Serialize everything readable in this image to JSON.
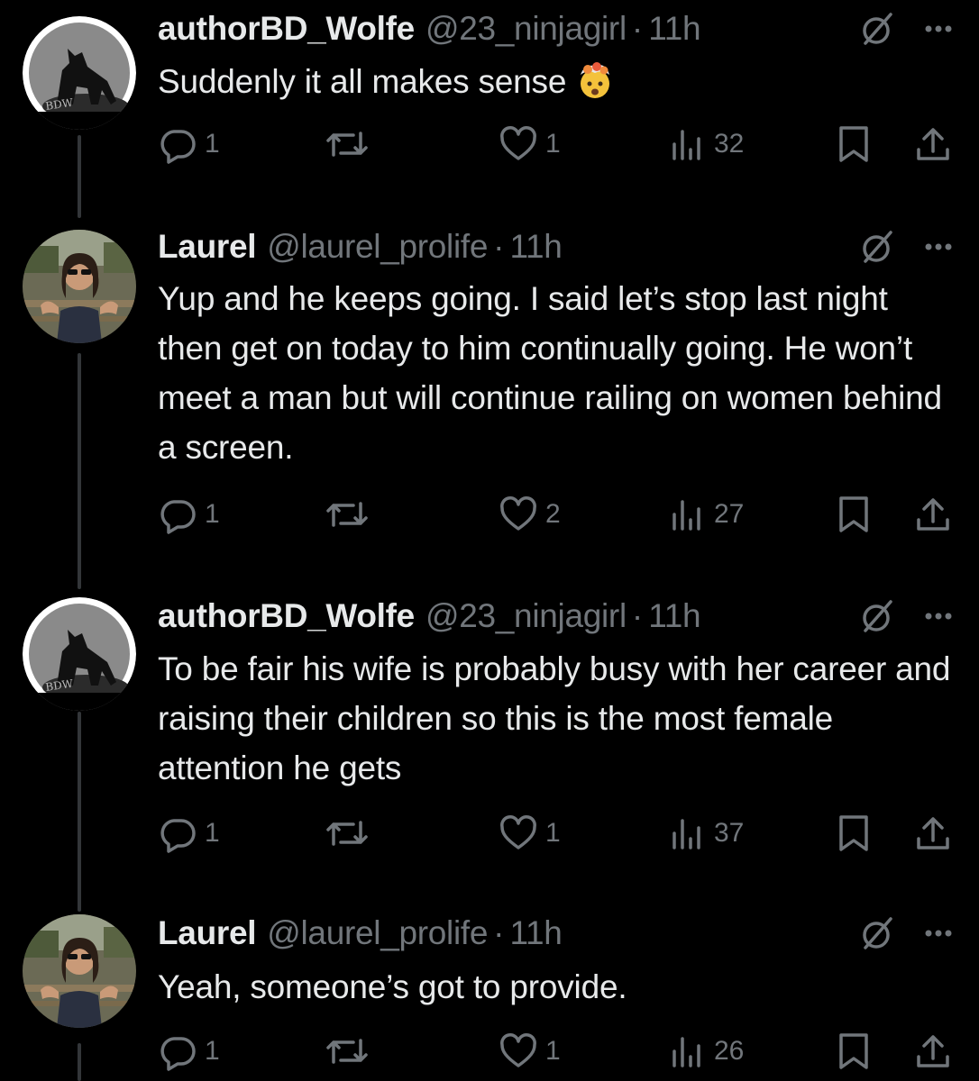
{
  "tweets": [
    {
      "name": "authorBD_Wolfe",
      "handle": "@23_ninjagirl",
      "separator": "·",
      "time": "11h",
      "text": "Suddenly it all makes sense",
      "emoji": "exploding-head",
      "avatar": "wolf-avatar",
      "avatar_text": "BDW",
      "replies": "1",
      "reposts": "",
      "likes": "1",
      "views": "32"
    },
    {
      "name": "Laurel",
      "handle": "@laurel_prolife",
      "separator": "·",
      "time": "11h",
      "text": "Yup and he keeps going. I said let’s stop last night then get on today to him continually going. He won’t meet a man but will continue railing on women behind a screen.",
      "avatar": "person-photo-avatar",
      "replies": "1",
      "reposts": "",
      "likes": "2",
      "views": "27"
    },
    {
      "name": "authorBD_Wolfe",
      "handle": "@23_ninjagirl",
      "separator": "·",
      "time": "11h",
      "text": "To be fair his wife is probably busy with her career and raising their children so this is the most female attention he gets",
      "avatar": "wolf-avatar",
      "avatar_text": "BDW",
      "replies": "1",
      "reposts": "",
      "likes": "1",
      "views": "37"
    },
    {
      "name": "Laurel",
      "handle": "@laurel_prolife",
      "separator": "·",
      "time": "11h",
      "text": "Yeah, someone’s got to provide.",
      "avatar": "person-photo-avatar",
      "replies": "1",
      "reposts": "",
      "likes": "1",
      "views": "26"
    }
  ],
  "icons": {
    "reply": "reply-icon",
    "repost": "repost-icon",
    "like": "like-icon",
    "views": "views-icon",
    "bookmark": "bookmark-icon",
    "share": "share-icon",
    "grok": "grok-icon",
    "more": "more-icon"
  },
  "colors": {
    "background": "#000000",
    "text": "#e7e9ea",
    "secondary": "#71767b",
    "thread_line": "#333639"
  }
}
